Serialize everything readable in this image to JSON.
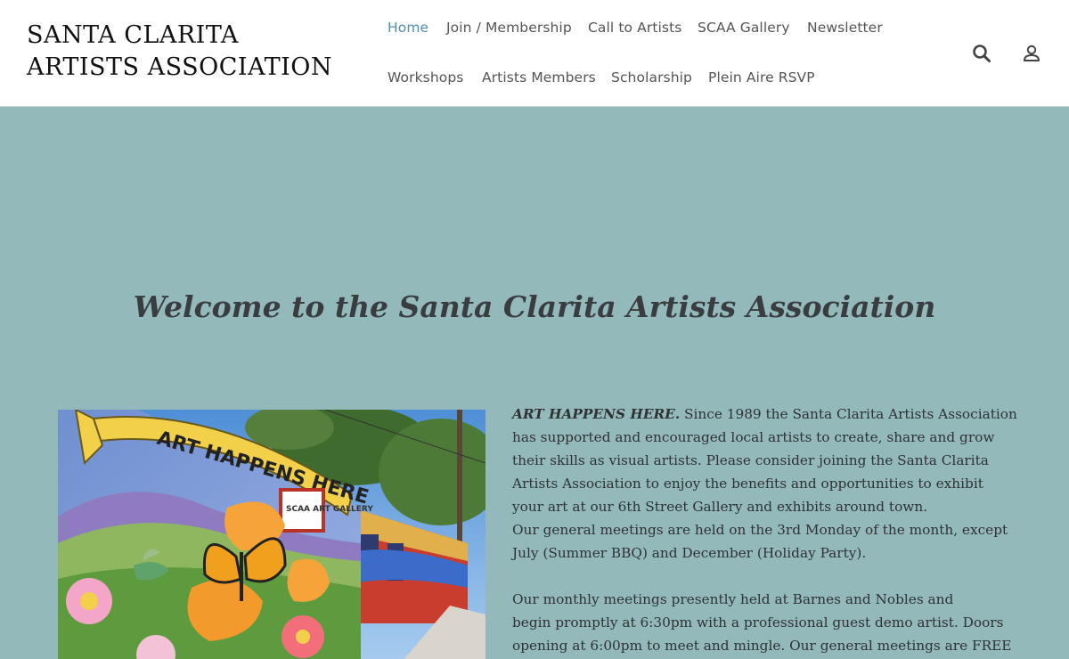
{
  "site": {
    "title_line1": "SANTA CLARITA",
    "title_line2": "ARTISTS ASSOCIATION"
  },
  "nav": {
    "row1": [
      "Home",
      "Join / Membership",
      "Call to Artists",
      "SCAA Gallery",
      "Newsletter"
    ],
    "row2": [
      "Workshops",
      "Artists Members",
      "Scholarship",
      "Plein Aire RSVP"
    ],
    "active": "Home",
    "icons": [
      "search-icon",
      "user-icon"
    ]
  },
  "main": {
    "heading": "Welcome to the Santa Clarita Artists Association",
    "mural": {
      "banner_text": "ART HAPPENS HERE",
      "sign_text": "SCAA ART GALLERY"
    },
    "intro_lead": "ART HAPPENS HERE.",
    "paragraph1": [
      "  Since 1989 the Santa Clarita Artists Association",
      "has supported and encouraged local artists to create, share and grow",
      "their skills as visual artists. Please consider joining the Santa Clarita",
      "Artists Association to enjoy the benefits and opportunities to exhibit",
      "your art at our 6th Street Gallery and exhibits around town."
    ],
    "paragraph2": [
      "Our general meetings are held on the 3rd Monday of the month, except",
      "July (Summer BBQ) and December (Holiday Party)."
    ],
    "paragraph3": [
      "Our monthly meetings presently held at Barnes and Nobles and",
      "begin promptly at 6:30pm with a professional guest demo artist. Doors",
      "opening at 6:00pm to meet and mingle. Our general meetings are FREE"
    ]
  },
  "colors": {
    "background": "#93b9bb",
    "nav_active": "#4f8fb5",
    "nav_text": "#555555",
    "header_bg": "#ffffff"
  }
}
